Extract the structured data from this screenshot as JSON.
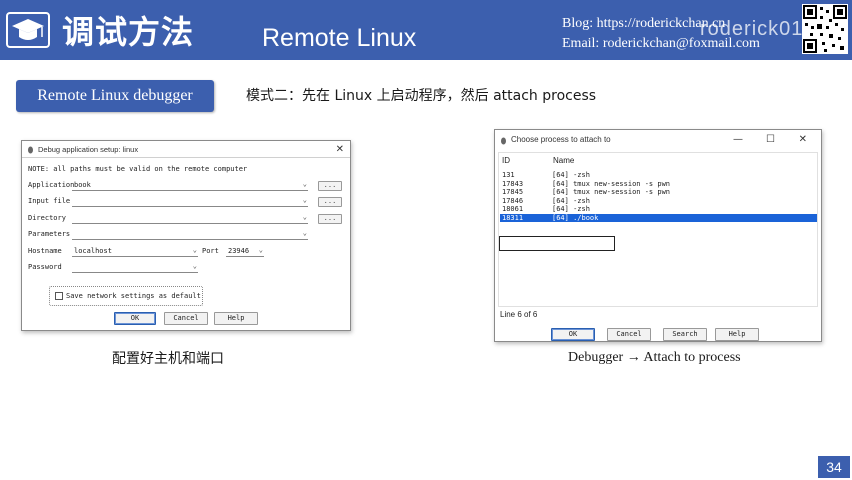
{
  "header": {
    "title_zh": "调试方法",
    "title_en": "Remote Linux",
    "blog": "Blog: https://roderickchan.cn",
    "email": "Email: roderickchan@foxmail.com",
    "watermark": "roderick01",
    "accent_color": "#3c5fae",
    "logo_icon": "graduation-cap-icon",
    "qr_icon": "qr-code"
  },
  "section": {
    "label": "Remote Linux debugger",
    "mode_text": "模式二：先在 Linux 上启动程序，然后 attach process"
  },
  "debug_dialog": {
    "title": "Debug application setup: linux",
    "note": "NOTE: all paths must be valid on the remote computer",
    "fields": {
      "application_label": "Application",
      "application_value": "book",
      "input_file_label": "Input file",
      "input_file_value": "",
      "directory_label": "Directory",
      "directory_value": "",
      "parameters_label": "Parameters",
      "parameters_value": "",
      "hostname_label": "Hostname",
      "hostname_value": "localhost",
      "port_label": "Port",
      "port_value": "23946",
      "password_label": "Password",
      "password_value": ""
    },
    "browse_label": "...",
    "save_checkbox_label": "Save network settings as default",
    "buttons": {
      "ok": "OK",
      "cancel": "Cancel",
      "help": "Help"
    }
  },
  "process_dialog": {
    "title": "Choose process to attach to",
    "window_controls": {
      "minimize": "—",
      "maximize": "☐",
      "close": "✕"
    },
    "columns": {
      "id": "ID",
      "name": "Name"
    },
    "rows": [
      {
        "id": "131",
        "name": "[64] -zsh"
      },
      {
        "id": "17843",
        "name": "[64] tmux new-session -s pwn"
      },
      {
        "id": "17845",
        "name": "[64] tmux new-session -s pwn"
      },
      {
        "id": "17846",
        "name": "[64] -zsh"
      },
      {
        "id": "18061",
        "name": "[64] -zsh"
      },
      {
        "id": "18311",
        "name": "[64] ./book"
      }
    ],
    "selected_index": 5,
    "status": "Line 6 of 6",
    "buttons": {
      "ok": "OK",
      "cancel": "Cancel",
      "search": "Search",
      "help": "Help"
    },
    "selection_color": "#1a63d8"
  },
  "captions": {
    "left": "配置好主机和端口",
    "right": "Debugger → Attach to process"
  },
  "page_number": "34"
}
